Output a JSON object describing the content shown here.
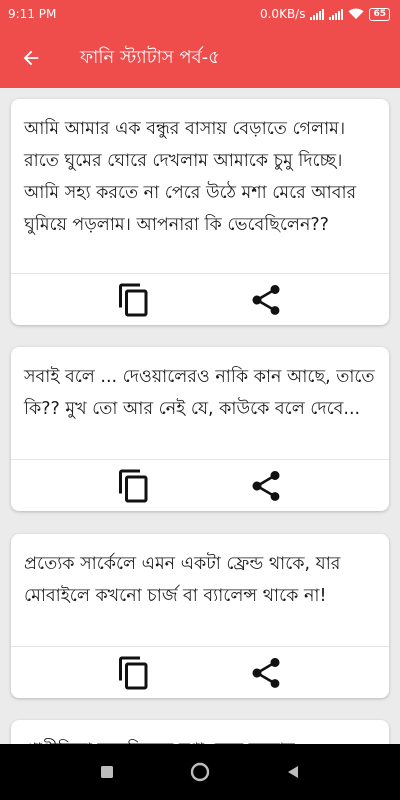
{
  "status_bar": {
    "time": "9:11 PM",
    "network_speed": "0.0KB/s",
    "battery_level": "65"
  },
  "app_bar": {
    "title": "ফানি স্ট্যাটাস পর্ব-৫",
    "back_icon": "arrow-back-icon"
  },
  "colors": {
    "accent": "#ef4c4c",
    "background": "#ebebeb"
  },
  "statuses": [
    {
      "text": "আমি আমার এক বন্ধুর বাসায় বেড়াতে গেলাম। রাতে ঘুমের ঘোরে দেখলাম আমাকে চুমু দিচ্ছে। আমি সহ্য করতে না পেরে উঠে মশা মেরে আবার ঘুমিয়ে পড়লাম। আপনারা কি ভেবেছিলেন??"
    },
    {
      "text": "সবাই বলে ... দেওয়ালেরও নাকি কান আছে, তাতে কি?? মুখ তো আর নেই যে, কাউকে বলে দেবে..."
    },
    {
      "text": "প্রত্যেক সার্কেলে এমন একটা ফ্রেন্ড থাকে, যার মোবাইলে কখনো চার্জ বা ব্যালেন্স থাকে না!"
    },
    {
      "text": "প্রাণীবিদ্যা বলেছিলেন মশা মেরে অন্যায়"
    }
  ],
  "card_actions": {
    "copy_icon": "copy-icon",
    "share_icon": "share-icon"
  },
  "nav_bar": {
    "icons": [
      "recents-icon",
      "home-icon",
      "back-triangle-icon"
    ]
  }
}
